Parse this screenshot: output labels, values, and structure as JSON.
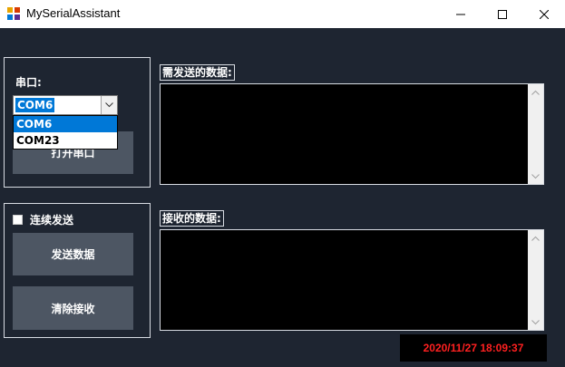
{
  "window": {
    "title": "MySerialAssistant",
    "icon": "app-grid-icon",
    "controls": [
      "minimize-icon",
      "maximize-icon",
      "close-icon"
    ]
  },
  "port_group": {
    "label": "串口:",
    "combo_value": "COM6",
    "options": [
      "COM6",
      "COM23"
    ],
    "selected_index": 0,
    "open_button": "打开串口"
  },
  "send_group": {
    "continuous_checkbox_label": "连续发送",
    "continuous_checked": false,
    "send_button": "发送数据",
    "clear_button": "清除接收"
  },
  "send_area": {
    "label": "需发送的数据:",
    "value": ""
  },
  "recv_area": {
    "label": "接收的数据:",
    "value": ""
  },
  "status": {
    "datetime": "2020/11/27 18:09:37"
  },
  "colors": {
    "background": "#1e2531",
    "button": "#4d5663",
    "accent": "#0078d7",
    "clock_text": "#ff2020"
  }
}
